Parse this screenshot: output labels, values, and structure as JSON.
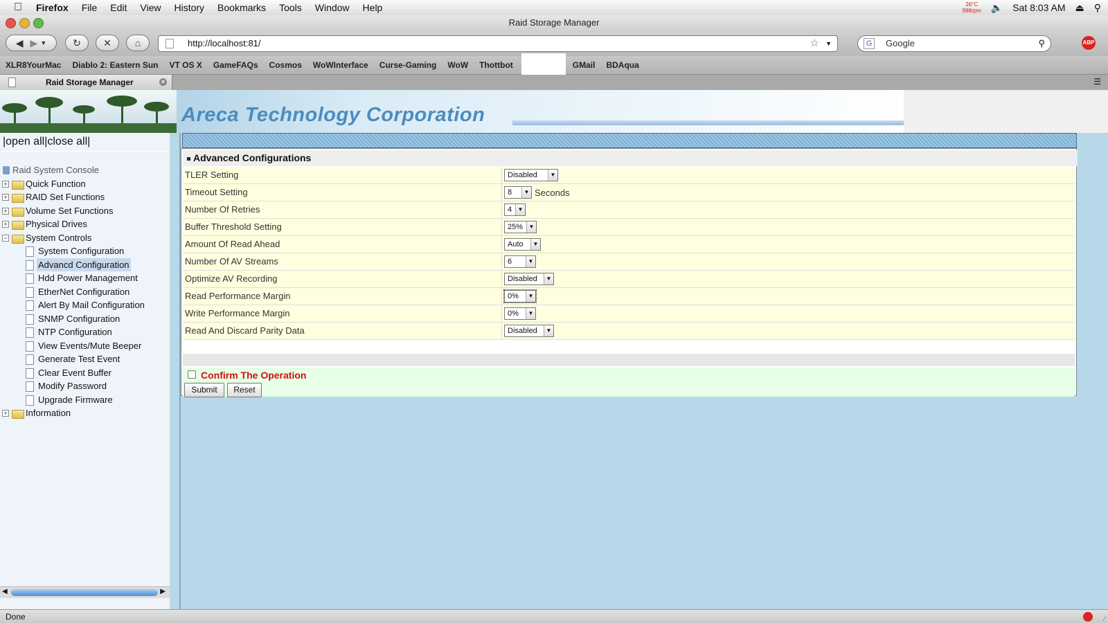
{
  "menubar": {
    "items": [
      "Firefox",
      "File",
      "Edit",
      "View",
      "History",
      "Bookmarks",
      "Tools",
      "Window",
      "Help"
    ],
    "temperature": "26°C",
    "fan": "998rpm",
    "clock": "Sat 8:03 AM"
  },
  "window": {
    "title": "Raid Storage Manager"
  },
  "toolbar": {
    "url": "http://localhost:81/",
    "search_placeholder": "Google",
    "abp_label": "ABP"
  },
  "bookmarks": [
    "XLR8YourMac",
    "Diablo 2: Eastern Sun",
    "VT OS X",
    "GameFAQs",
    "Cosmos",
    "WoWInterface",
    "Curse-Gaming",
    "WoW",
    "Thottbot",
    "GMail",
    "BDAqua"
  ],
  "tab": {
    "title": "Raid Storage Manager"
  },
  "banner": {
    "company": "Areca Technology Corporation"
  },
  "sidebar": {
    "header": "|open all|close all|",
    "root": "Raid System Console",
    "top_items": [
      "Quick Function",
      "RAID Set Functions",
      "Volume Set Functions",
      "Physical Drives",
      "System Controls"
    ],
    "system_controls_items": [
      "System Configuration",
      "Advancd Configuration",
      "Hdd Power Management",
      "EtherNet Configuration",
      "Alert By Mail Configuration",
      "SNMP Configuration",
      "NTP Configuration",
      "View Events/Mute Beeper",
      "Generate Test Event",
      "Clear Event Buffer",
      "Modify Password",
      "Upgrade Firmware"
    ],
    "last_item": "Information"
  },
  "form": {
    "title": "Advanced Configurations",
    "rows": [
      {
        "label": "TLER Setting",
        "value": "Disabled",
        "unit": ""
      },
      {
        "label": "Timeout Setting",
        "value": "8",
        "unit": "Seconds"
      },
      {
        "label": "Number Of Retries",
        "value": "4",
        "unit": ""
      },
      {
        "label": "Buffer Threshold Setting",
        "value": "25%",
        "unit": ""
      },
      {
        "label": "Amount Of Read Ahead",
        "value": "Auto",
        "unit": ""
      },
      {
        "label": "Number Of AV Streams",
        "value": "6",
        "unit": ""
      },
      {
        "label": "Optimize AV Recording",
        "value": "Disabled",
        "unit": ""
      },
      {
        "label": "Read Performance Margin",
        "value": "0%",
        "unit": ""
      },
      {
        "label": "Write Performance Margin",
        "value": "0%",
        "unit": ""
      },
      {
        "label": "Read And Discard Parity Data",
        "value": "Disabled",
        "unit": ""
      }
    ],
    "confirm_label": "Confirm The Operation",
    "submit_label": "Submit",
    "reset_label": "Reset"
  },
  "status": {
    "text": "Done"
  },
  "colors": {
    "accent": "#4c8cbd",
    "confirm": "#cc1111",
    "row_bg": "#ffffe0"
  }
}
